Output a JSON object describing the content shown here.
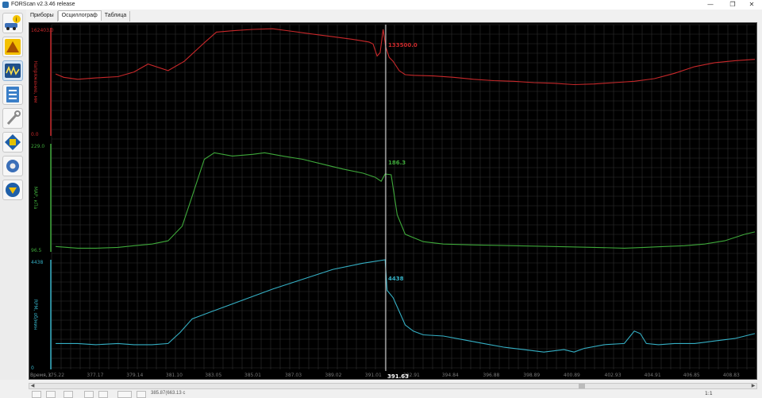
{
  "window": {
    "title": "FORScan v2.3.46 release",
    "minimize": "—",
    "maximize": "❐",
    "close": "✕"
  },
  "tabs": [
    {
      "label": "Приборы"
    },
    {
      "label": "Осциллограф"
    },
    {
      "label": "Таблица"
    }
  ],
  "sidebar": {
    "items": [
      {
        "icon": "car-info-icon"
      },
      {
        "icon": "warning-icon"
      },
      {
        "icon": "oscilloscope-icon"
      },
      {
        "icon": "checklist-icon"
      },
      {
        "icon": "wrench-icon"
      },
      {
        "icon": "chip-icon"
      },
      {
        "icon": "gear-icon"
      },
      {
        "icon": "ford-logo-icon"
      }
    ]
  },
  "chart_data": {
    "type": "line",
    "x_axis_label": "Время, с",
    "x_ticks": [
      "375.22",
      "377.17",
      "379.14",
      "381.10",
      "383.05",
      "385.01",
      "387.03",
      "389.02",
      "391.01",
      "392.91",
      "394.84",
      "396.88",
      "398.89",
      "400.89",
      "402.93",
      "404.91",
      "406.85",
      "408.83"
    ],
    "cursor": {
      "x": 391.63,
      "label": "391.63"
    },
    "grid": true,
    "background": "#000000",
    "series": [
      {
        "name": "Напряжение, мм",
        "color": "#c8282a",
        "range_max_label": "162403.0",
        "range_min_label": "0.0",
        "cursor_value": "133500.0",
        "x": [
          375.2,
          375.6,
          376.3,
          377.2,
          378.3,
          379.1,
          379.8,
          380.8,
          381.6,
          382.6,
          383.2,
          384.0,
          385.0,
          386.0,
          387.0,
          388.0,
          389.0,
          390.0,
          390.8,
          391.0,
          391.2,
          391.35,
          391.5,
          391.63,
          391.8,
          392.0,
          392.3,
          392.6,
          393.0,
          394.0,
          395.0,
          396.0,
          397.0,
          398.0,
          399.0,
          400.0,
          401.0,
          402.0,
          403.0,
          404.0,
          405.0,
          406.0,
          407.0,
          408.0,
          409.0,
          410.0
        ],
        "values": [
          93000,
          88000,
          85000,
          87000,
          89000,
          96000,
          108000,
          98000,
          112000,
          140000,
          156000,
          158000,
          160000,
          161000,
          157000,
          153000,
          149000,
          145000,
          141000,
          138000,
          120000,
          125000,
          160000,
          133500,
          118000,
          112000,
          98000,
          92000,
          91000,
          90000,
          88000,
          85000,
          83000,
          82000,
          80000,
          79000,
          77000,
          78000,
          80000,
          82000,
          86000,
          94000,
          104000,
          110000,
          113000,
          115000
        ]
      },
      {
        "name": "MAP, кПа",
        "color": "#3ea83a",
        "range_max_label": "229.0",
        "range_min_label": "96.5",
        "cursor_value": "186.3",
        "x": [
          375.2,
          376.3,
          377.2,
          378.3,
          379.1,
          380.0,
          380.8,
          381.5,
          382.0,
          382.6,
          383.1,
          384.0,
          385.0,
          385.6,
          386.5,
          387.5,
          388.5,
          389.5,
          390.5,
          391.1,
          391.4,
          391.6,
          391.9,
          392.2,
          392.6,
          393.5,
          394.5,
          396.0,
          398.0,
          400.0,
          402.0,
          403.5,
          404.5,
          405.5,
          406.5,
          407.5,
          408.5,
          409.5,
          410.0
        ],
        "values": [
          103,
          101,
          101,
          102,
          104,
          106,
          110,
          128,
          165,
          210,
          218,
          214,
          216,
          218,
          214,
          210,
          204,
          198,
          193,
          188,
          183,
          192,
          191,
          142,
          118,
          109,
          106,
          105,
          104,
          103,
          102,
          101,
          102,
          103,
          104,
          106,
          110,
          118,
          121
        ]
      },
      {
        "name": "RPM, об/мин",
        "color": "#35b0c5",
        "range_max_label": "4438",
        "range_min_label": "0",
        "cursor_value": "4438",
        "x": [
          375.2,
          376.3,
          377.2,
          378.3,
          379.1,
          380.0,
          380.8,
          381.4,
          382.0,
          383.0,
          384.5,
          386.0,
          387.5,
          389.0,
          390.5,
          391.6,
          391.7,
          392.0,
          392.3,
          392.6,
          393.0,
          393.5,
          394.5,
          395.5,
          396.5,
          397.5,
          398.5,
          399.5,
          400.5,
          401.0,
          401.5,
          402.5,
          403.5,
          404.0,
          404.3,
          404.6,
          405.2,
          406.0,
          407.0,
          408.0,
          409.0,
          410.0
        ],
        "values": [
          1050,
          1050,
          1000,
          1050,
          1000,
          1000,
          1050,
          1500,
          2050,
          2350,
          2800,
          3250,
          3650,
          4050,
          4300,
          4438,
          3200,
          2900,
          2350,
          1800,
          1550,
          1400,
          1350,
          1200,
          1050,
          900,
          800,
          700,
          800,
          700,
          850,
          1000,
          1050,
          1550,
          1450,
          1050,
          1000,
          1050,
          1050,
          1150,
          1250,
          1450
        ]
      }
    ]
  },
  "statusbar": {
    "coords_text": "385.87(663.13 c",
    "zoom_text": "1:1"
  }
}
